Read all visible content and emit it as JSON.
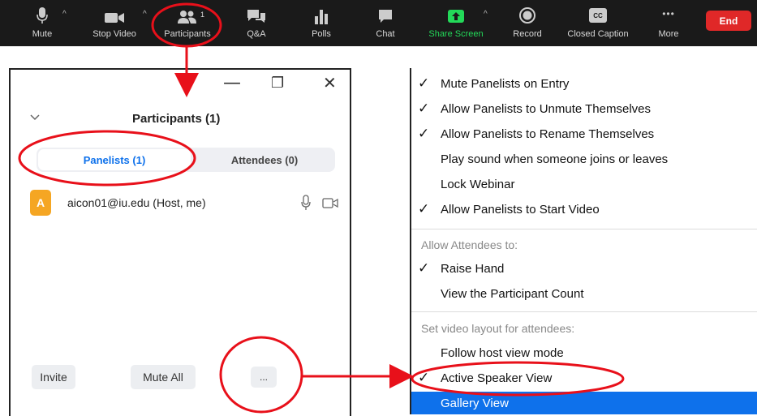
{
  "toolbar": {
    "mute": "Mute",
    "stop_video": "Stop Video",
    "participants": "Participants",
    "participants_count": "1",
    "qa": "Q&A",
    "polls": "Polls",
    "chat": "Chat",
    "share_screen": "Share Screen",
    "record": "Record",
    "closed_caption": "Closed Caption",
    "cc_glyph": "CC",
    "more": "More",
    "more_glyph": "•••",
    "end": "End"
  },
  "participants_panel": {
    "title": "Participants (1)",
    "tabs": [
      "Panelists (1)",
      "Attendees (0)"
    ],
    "participant": {
      "initial": "A",
      "name": "aicon01@iu.edu (Host, me)"
    },
    "buttons": {
      "invite": "Invite",
      "mute_all": "Mute All",
      "more": "..."
    },
    "window_controls": {
      "minimize": "—",
      "restore": "❐",
      "close": "✕"
    }
  },
  "menu": {
    "items_top": [
      {
        "label": "Mute Panelists on Entry",
        "checked": true
      },
      {
        "label": "Allow Panelists to Unmute Themselves",
        "checked": true
      },
      {
        "label": "Allow Panelists to Rename Themselves",
        "checked": true
      },
      {
        "label": "Play sound when someone joins or leaves",
        "checked": false
      },
      {
        "label": "Lock Webinar",
        "checked": false
      },
      {
        "label": "Allow Panelists to Start Video",
        "checked": true
      }
    ],
    "section_attendees": "Allow Attendees to:",
    "items_attendees": [
      {
        "label": "Raise Hand",
        "checked": true
      },
      {
        "label": "View the Participant Count",
        "checked": false
      }
    ],
    "section_layout": "Set video layout for attendees:",
    "items_layout": [
      {
        "label": "Follow host view mode",
        "checked": false
      },
      {
        "label": "Active Speaker View",
        "checked": true
      },
      {
        "label": "Gallery View",
        "checked": false
      }
    ],
    "check_glyph": "✓"
  },
  "colors": {
    "annotation_red": "#e8101a",
    "accent_blue": "#0e71eb",
    "share_green": "#23d959",
    "end_red": "#e02828",
    "avatar_orange": "#f5a623"
  }
}
